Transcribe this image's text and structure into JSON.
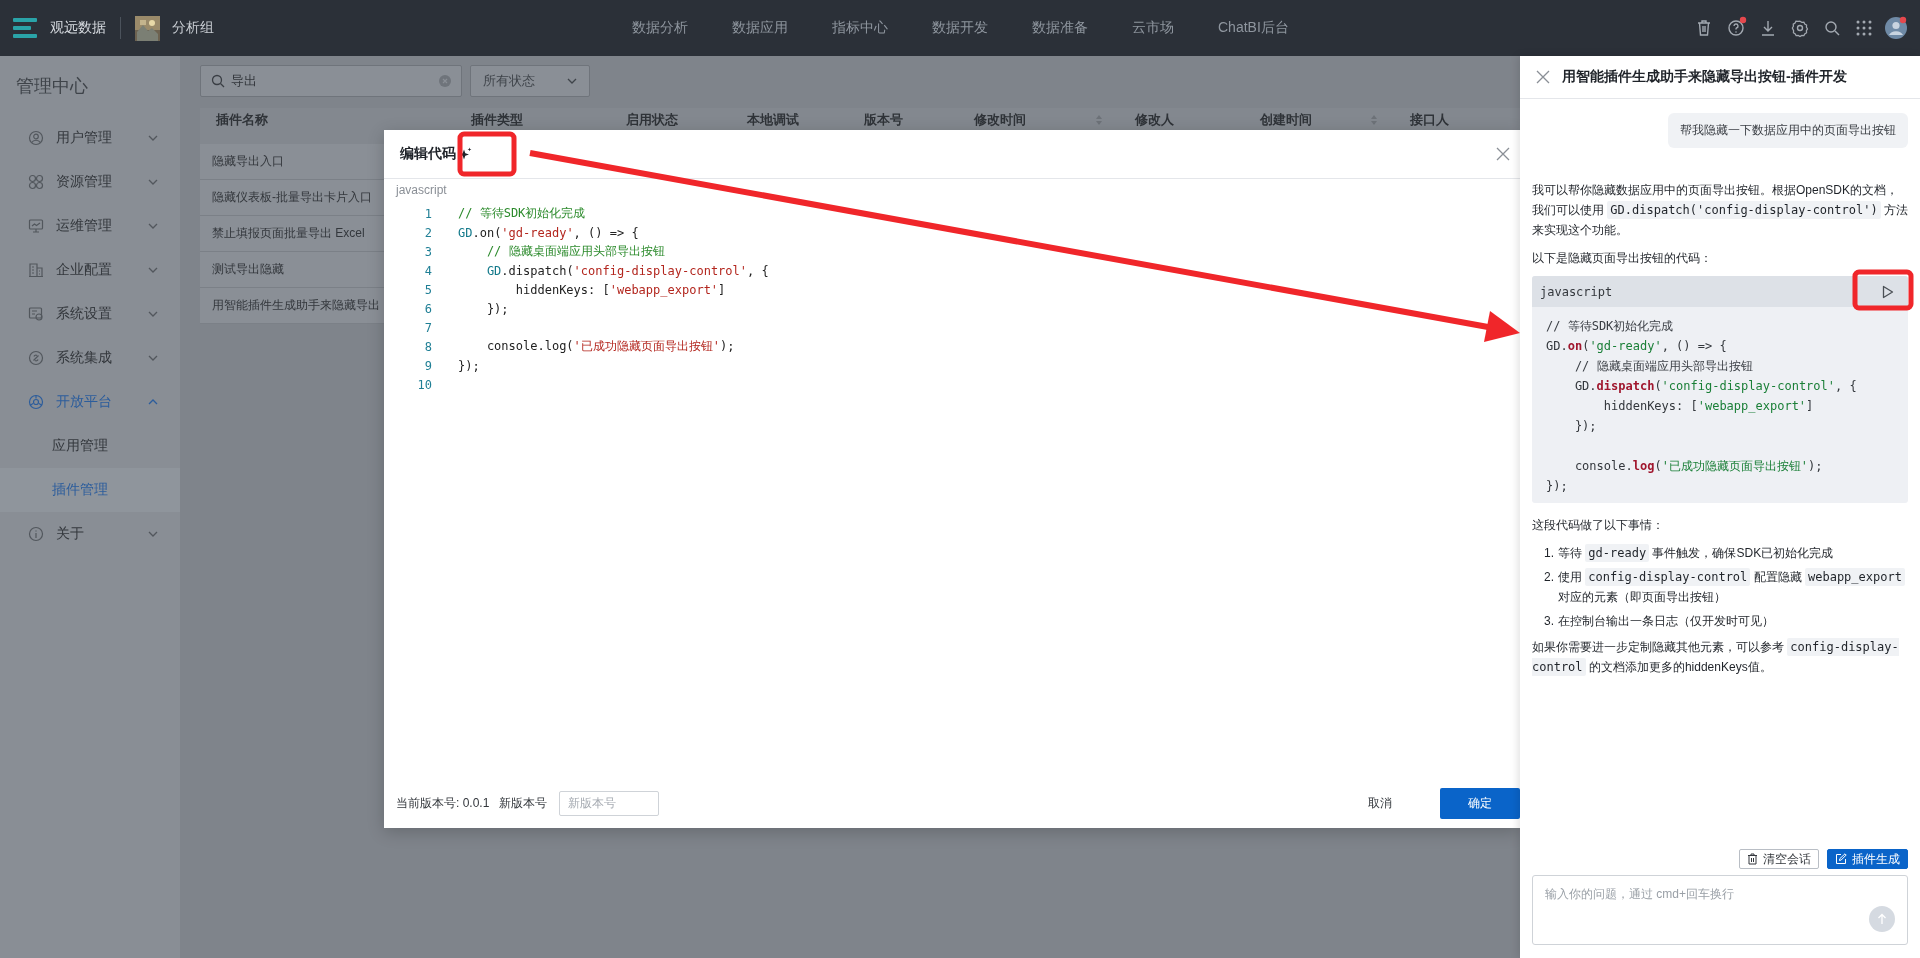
{
  "top_bar": {
    "brand": "观远数据",
    "group": "分析组",
    "nav": [
      {
        "label": "数据分析",
        "selected": false
      },
      {
        "label": "数据应用",
        "selected": false
      },
      {
        "label": "指标中心",
        "selected": false
      },
      {
        "label": "数据开发",
        "selected": false
      },
      {
        "label": "数据准备",
        "selected": false
      },
      {
        "label": "云市场",
        "selected": false
      },
      {
        "label": "ChatBI后台",
        "selected": false
      }
    ],
    "icons": [
      {
        "kind": "trash",
        "badge": false
      },
      {
        "kind": "help",
        "badge": true
      },
      {
        "kind": "download",
        "badge": false
      },
      {
        "kind": "gear",
        "badge": false
      },
      {
        "kind": "search",
        "badge": false
      },
      {
        "kind": "grid",
        "badge": false
      },
      {
        "kind": "avatar",
        "badge": true
      }
    ]
  },
  "sidebar": {
    "title": "管理中心",
    "items": [
      {
        "label": "用户管理",
        "kind": "user",
        "expanded": false
      },
      {
        "label": "资源管理",
        "kind": "apps",
        "expanded": false
      },
      {
        "label": "运维管理",
        "kind": "monitor",
        "expanded": false
      },
      {
        "label": "企业配置",
        "kind": "building",
        "expanded": false
      },
      {
        "label": "系统设置",
        "kind": "settings",
        "expanded": false
      },
      {
        "label": "系统集成",
        "kind": "link",
        "expanded": false
      },
      {
        "label": "开放平台",
        "kind": "platform",
        "expanded": true,
        "children": [
          {
            "label": "应用管理",
            "selected": false
          },
          {
            "label": "插件管理",
            "selected": true
          }
        ]
      },
      {
        "label": "关于",
        "kind": "info",
        "expanded": false
      }
    ]
  },
  "filters": {
    "search": {
      "value": "导出"
    },
    "status": {
      "value": "所有状态"
    }
  },
  "table": {
    "columns": [
      {
        "label": "插件名称",
        "sortable": false
      },
      {
        "label": "插件类型",
        "sortable": false
      },
      {
        "label": "启用状态",
        "sortable": false
      },
      {
        "label": "本地调试",
        "sortable": false
      },
      {
        "label": "版本号",
        "sortable": false
      },
      {
        "label": "修改时间",
        "sortable": true
      },
      {
        "label": "修改人",
        "sortable": false
      },
      {
        "label": "创建时间",
        "sortable": true
      },
      {
        "label": "接口人",
        "sortable": false
      }
    ],
    "rows": [
      [
        "隐藏导出入口"
      ],
      [
        "隐藏仪表板-批量导出卡片入口"
      ],
      [
        "禁止填报页面批量导出 Excel"
      ],
      [
        "测试导出隐藏"
      ],
      [
        "用智能插件生成助手来隐藏导出"
      ]
    ]
  },
  "modal": {
    "title": "编辑代码",
    "language": "javascript",
    "lines": [
      {
        "no": "1",
        "tokens": [
          {
            "t": "// 等待SDK初始化完成",
            "kind": "comment"
          }
        ]
      },
      {
        "no": "2",
        "tokens": [
          {
            "t": "GD",
            "kind": "object"
          },
          {
            "t": ".on(",
            "kind": "plain"
          },
          {
            "t": "'gd-ready'",
            "kind": "string"
          },
          {
            "t": ", () => {",
            "kind": "plain"
          }
        ]
      },
      {
        "no": "3",
        "tokens": [
          {
            "t": "    // 隐藏桌面端应用头部导出按钮",
            "kind": "comment"
          }
        ]
      },
      {
        "no": "4",
        "tokens": [
          {
            "t": "    GD",
            "kind": "object"
          },
          {
            "t": ".dispatch(",
            "kind": "plain"
          },
          {
            "t": "'config-display-control'",
            "kind": "string"
          },
          {
            "t": ", {",
            "kind": "plain"
          }
        ]
      },
      {
        "no": "5",
        "tokens": [
          {
            "t": "        hiddenKeys: [",
            "kind": "plain"
          },
          {
            "t": "'webapp_export'",
            "kind": "string"
          },
          {
            "t": "]",
            "kind": "plain"
          }
        ]
      },
      {
        "no": "6",
        "tokens": [
          {
            "t": "    });",
            "kind": "plain"
          }
        ]
      },
      {
        "no": "7"
      },
      {
        "no": "8",
        "tokens": [
          {
            "t": "    console.log(",
            "kind": "plain"
          },
          {
            "t": "'已成功隐藏页面导出按钮'",
            "kind": "string"
          },
          {
            "t": ");",
            "kind": "plain"
          }
        ]
      },
      {
        "no": "9",
        "tokens": [
          {
            "t": "});",
            "kind": "plain"
          }
        ]
      },
      {
        "no": "10"
      }
    ],
    "current_version": "当前版本号: 0.0.1",
    "new_version_label": "新版本号",
    "new_version": {
      "placeholder": "新版本号"
    },
    "buttons": [
      {
        "label": "取消",
        "kind": "cancel"
      },
      {
        "label": "确定",
        "kind": "confirm"
      }
    ]
  },
  "chat_panel": {
    "title": "用智能插件生成助手来隐藏导出按钮-插件开发",
    "messages": [
      {
        "kind": "user",
        "text": "帮我隐藏一下数据应用中的页面导出按钮"
      },
      {
        "kind": "assistant",
        "blocks": [
          {
            "kind": "paragraph",
            "parts": [
              {
                "text": "我可以帮你隐藏数据应用中的页面导出按钮。根据OpenSDK的文档，我们可以使用 ",
                "kind": "text"
              },
              {
                "text": "GD.dispatch('config-display-control')",
                "kind": "code"
              },
              {
                "text": " 方法来实现这个功能。",
                "kind": "text"
              }
            ]
          },
          {
            "kind": "paragraph",
            "parts": [
              {
                "text": "以下是隐藏页面导出按钮的代码：",
                "kind": "text"
              }
            ]
          },
          {
            "kind": "code_block",
            "language": "javascript",
            "lines": [
              {
                "kind": "code",
                "tokens": [
                  {
                    "t": "// 等待SDK初始化完成",
                    "kind": "comment"
                  }
                ]
              },
              {
                "kind": "code",
                "tokens": [
                  {
                    "t": "GD.",
                    "kind": "plain"
                  },
                  {
                    "t": "on",
                    "kind": "method"
                  },
                  {
                    "t": "(",
                    "kind": "plain"
                  },
                  {
                    "t": "'gd-ready'",
                    "kind": "string"
                  },
                  {
                    "t": ", () => {",
                    "kind": "plain"
                  }
                ]
              },
              {
                "kind": "code",
                "tokens": [
                  {
                    "t": "    // 隐藏桌面端应用头部导出按钮",
                    "kind": "comment"
                  }
                ]
              },
              {
                "kind": "code",
                "tokens": [
                  {
                    "t": "    GD.",
                    "kind": "plain"
                  },
                  {
                    "t": "dispatch",
                    "kind": "method"
                  },
                  {
                    "t": "(",
                    "kind": "plain"
                  },
                  {
                    "t": "'config-display-control'",
                    "kind": "string"
                  },
                  {
                    "t": ", {",
                    "kind": "plain"
                  }
                ]
              },
              {
                "kind": "code",
                "tokens": [
                  {
                    "t": "        hiddenKeys: [",
                    "kind": "plain"
                  },
                  {
                    "t": "'webapp_export'",
                    "kind": "string"
                  },
                  {
                    "t": "]",
                    "kind": "plain"
                  }
                ]
              },
              {
                "kind": "code",
                "tokens": [
                  {
                    "t": "    });",
                    "kind": "plain"
                  }
                ]
              },
              {
                "kind": "blank"
              },
              {
                "kind": "code",
                "tokens": [
                  {
                    "t": "    console.",
                    "kind": "plain"
                  },
                  {
                    "t": "log",
                    "kind": "method"
                  },
                  {
                    "t": "(",
                    "kind": "plain"
                  },
                  {
                    "t": "'已成功隐藏页面导出按钮'",
                    "kind": "string"
                  },
                  {
                    "t": ");",
                    "kind": "plain"
                  }
                ]
              },
              {
                "kind": "code",
                "tokens": [
                  {
                    "t": "});",
                    "kind": "plain"
                  }
                ]
              }
            ]
          },
          {
            "kind": "paragraph",
            "parts": [
              {
                "text": "这段代码做了以下事情：",
                "kind": "text"
              }
            ]
          },
          {
            "kind": "ordered_list",
            "items": [
              {
                "marker": "1.",
                "parts": [
                  {
                    "text": "等待 ",
                    "kind": "text"
                  },
                  {
                    "text": "gd-ready",
                    "kind": "code"
                  },
                  {
                    "text": " 事件触发，确保SDK已初始化完成",
                    "kind": "text"
                  }
                ]
              },
              {
                "marker": "2.",
                "parts": [
                  {
                    "text": "使用 ",
                    "kind": "text"
                  },
                  {
                    "text": "config-display-control",
                    "kind": "code"
                  },
                  {
                    "text": " 配置隐藏 ",
                    "kind": "text"
                  },
                  {
                    "text": "webapp_export",
                    "kind": "code"
                  },
                  {
                    "text": " 对应的元素（即页面导出按钮）",
                    "kind": "text"
                  }
                ]
              },
              {
                "marker": "3.",
                "parts": [
                  {
                    "text": "在控制台输出一条日志（仅开发时可见）",
                    "kind": "text"
                  }
                ]
              }
            ]
          },
          {
            "kind": "paragraph",
            "parts": [
              {
                "text": "如果你需要进一步定制隐藏其他元素，可以参考 ",
                "kind": "text"
              },
              {
                "text": "config-display-control",
                "kind": "code"
              },
              {
                "text": " 的文档添加更多的hiddenKeys值。",
                "kind": "text"
              }
            ]
          }
        ]
      }
    ],
    "actions": [
      {
        "label": "清空会话",
        "kind": "clear"
      },
      {
        "label": "插件生成",
        "kind": "generate"
      }
    ],
    "input": {
      "placeholder": "输入你的问题，通过 cmd+回车换行"
    }
  }
}
